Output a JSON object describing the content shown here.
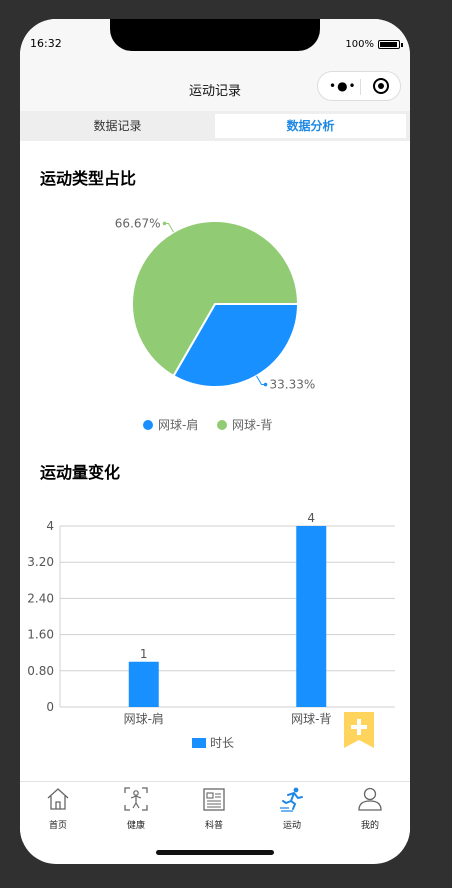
{
  "status": {
    "time": "16:32",
    "battery": "100%",
    "battery_level": 1.0
  },
  "navbar": {
    "title": "运动记录",
    "more_icon": "more-dots-icon",
    "close_icon": "target-icon"
  },
  "tabs": [
    {
      "label": "数据记录"
    },
    {
      "label": "数据分析",
      "active": true
    }
  ],
  "sections": {
    "pie_title": "运动类型占比",
    "bar_title": "运动量变化"
  },
  "colors": {
    "blue": "#1890ff",
    "green": "#91cb74",
    "accent": "#1e88e5"
  },
  "chart_data": [
    {
      "type": "pie",
      "title": "",
      "categories": [
        "网球-肩",
        "网球-背"
      ],
      "values": [
        1,
        2
      ],
      "labels": [
        "33.33%",
        "66.67%"
      ],
      "colors": [
        "#1890ff",
        "#91cb74"
      ],
      "legend": "bottom"
    },
    {
      "type": "bar",
      "title": "",
      "categories": [
        "网球-肩",
        "网球-背"
      ],
      "series": [
        {
          "name": "时长",
          "values": [
            1,
            4
          ]
        }
      ],
      "yticks": [
        "0",
        "0.80",
        "1.60",
        "2.40",
        "3.20",
        "4"
      ],
      "ylim": [
        0,
        4
      ],
      "grid": true,
      "legend": "bottom"
    }
  ],
  "tabbar": [
    {
      "label": "首页",
      "icon": "home-icon"
    },
    {
      "label": "健康",
      "icon": "health-icon"
    },
    {
      "label": "科普",
      "icon": "news-icon"
    },
    {
      "label": "运动",
      "icon": "running-icon",
      "active": true
    },
    {
      "label": "我的",
      "icon": "user-icon"
    }
  ],
  "fab_icon": "add-bookmark-icon"
}
